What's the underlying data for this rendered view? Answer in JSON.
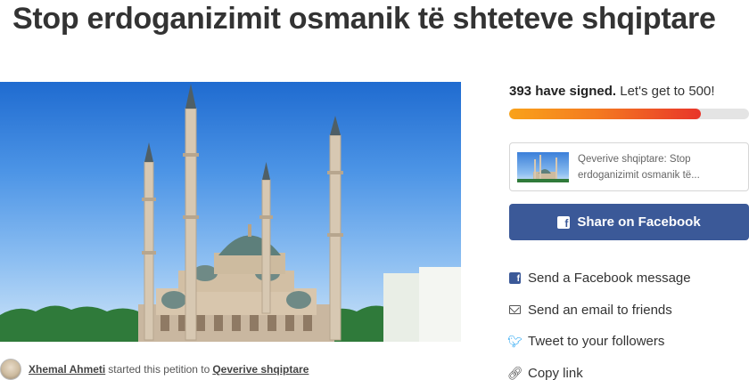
{
  "page": {
    "title": "Stop erdoganizimit osmanik të shteteve shqiptare"
  },
  "author": {
    "name": "Xhemal Ahmeti",
    "middle_text": "started this petition to",
    "target": "Qeverive shqiptare"
  },
  "progress": {
    "signed_bold": "393 have signed.",
    "goal_text": "Let's get to 500!",
    "signed_count": 393,
    "goal_count": 500,
    "fill_fraction": 0.8
  },
  "preview_card": {
    "line1": "Qeverive shqiptare: Stop",
    "line2": "erdoganizimit osmanik të..."
  },
  "share": {
    "facebook_button": "Share on Facebook",
    "items": [
      {
        "label": "Send a Facebook message",
        "icon": "facebook-icon"
      },
      {
        "label": "Send an email to friends",
        "icon": "email-icon"
      },
      {
        "label": "Tweet to your followers",
        "icon": "twitter-icon"
      },
      {
        "label": "Copy link",
        "icon": "link-icon"
      }
    ]
  },
  "colors": {
    "facebook": "#3b5998",
    "progress_start": "#f9a21a",
    "progress_end": "#e8352a",
    "twitter": "#1da1f2"
  }
}
